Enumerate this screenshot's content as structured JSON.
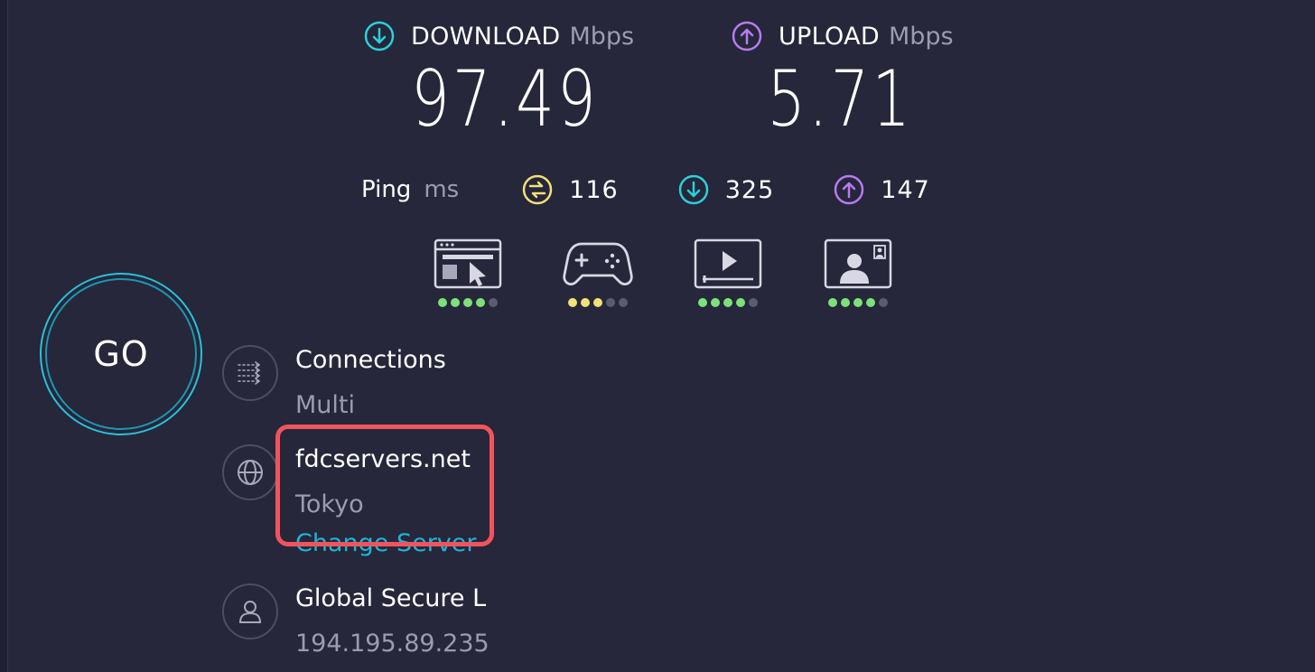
{
  "download": {
    "label": "DOWNLOAD",
    "unit": "Mbps",
    "value": "97.49",
    "icon": "arrow-down-circle-icon",
    "color": "#2bd0d9"
  },
  "upload": {
    "label": "UPLOAD",
    "unit": "Mbps",
    "value": "5.71",
    "icon": "arrow-up-circle-icon",
    "color": "#b77bf2"
  },
  "ping": {
    "label": "Ping",
    "unit": "ms",
    "idle": {
      "value": "116",
      "icon": "latency-icon",
      "color": "#f2e07a"
    },
    "download": {
      "value": "325",
      "icon": "arrow-down-circle-icon",
      "color": "#2bd0d9"
    },
    "upload": {
      "value": "147",
      "icon": "arrow-up-circle-icon",
      "color": "#b77bf2"
    }
  },
  "quality": [
    {
      "name": "browsing",
      "icon": "browser-cursor-icon",
      "rating": 4,
      "max": 5,
      "color": "#7ee07a"
    },
    {
      "name": "gaming",
      "icon": "gamepad-icon",
      "rating": 3,
      "max": 5,
      "color": "#f2e07a"
    },
    {
      "name": "streaming",
      "icon": "video-player-icon",
      "rating": 4,
      "max": 5,
      "color": "#7ee07a"
    },
    {
      "name": "video-chat",
      "icon": "video-call-icon",
      "rating": 4,
      "max": 5,
      "color": "#7ee07a"
    }
  ],
  "go_button": {
    "label": "GO",
    "ring_color": "#2bc1d9"
  },
  "connections": {
    "title": "Connections",
    "value": "Multi",
    "icon": "connections-icon"
  },
  "server": {
    "host": "fdcservers.net",
    "location": "Tokyo",
    "change_label": "Change Server",
    "icon": "globe-icon"
  },
  "provider": {
    "name": "Global Secure L",
    "ip": "194.195.89.235",
    "icon": "user-icon"
  },
  "highlight_color": "#f0545e"
}
